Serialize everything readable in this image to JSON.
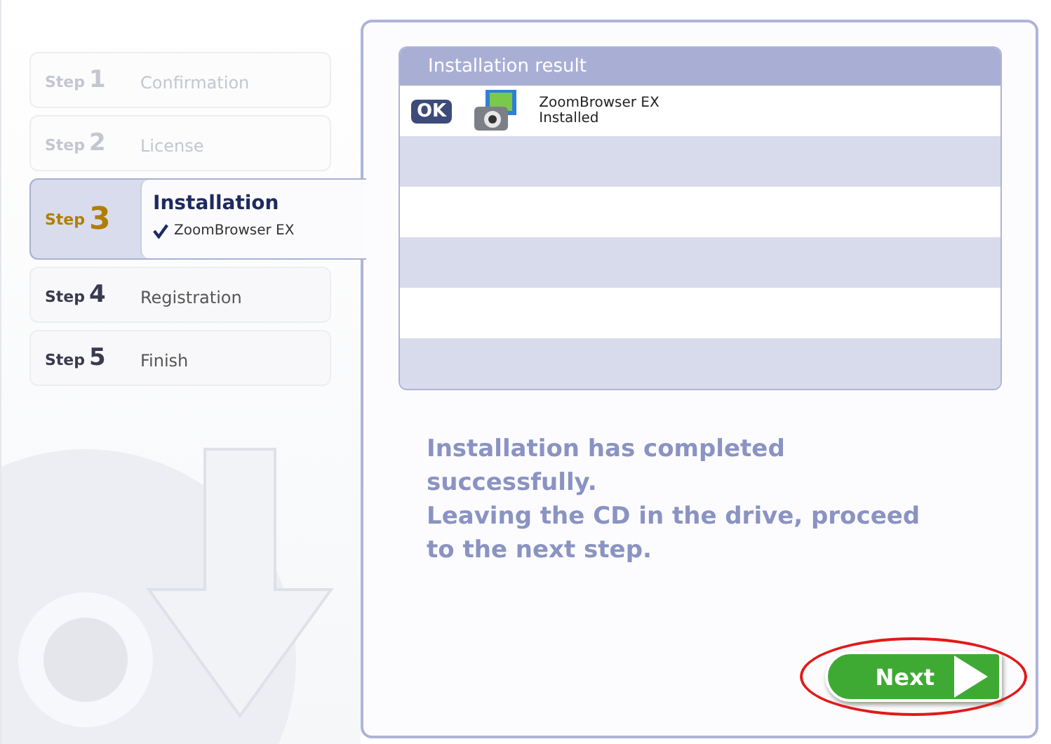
{
  "steps": [
    {
      "word": "Step",
      "number": "1",
      "label": "Confirmation",
      "disabled": true,
      "selected": false
    },
    {
      "word": "Step",
      "number": "2",
      "label": "License",
      "disabled": true,
      "selected": false
    },
    {
      "word": "Step",
      "number": "3",
      "label": "Installation",
      "disabled": false,
      "selected": true,
      "children": [
        {
          "label": "ZoomBrowser EX",
          "checked": true
        }
      ]
    },
    {
      "word": "Step",
      "number": "4",
      "label": "Registration",
      "disabled": false,
      "selected": false
    },
    {
      "word": "Step",
      "number": "5",
      "label": "Finish",
      "disabled": false,
      "selected": false
    }
  ],
  "result": {
    "title": "Installation result",
    "rows": [
      {
        "badge": "OK",
        "name": "ZoomBrowser EX",
        "state": "Installed"
      }
    ]
  },
  "message": [
    "Installation has completed successfully.",
    "Leaving the CD in the drive, proceed to the next step."
  ],
  "next_button": {
    "label": "Next",
    "highlighted": true
  }
}
